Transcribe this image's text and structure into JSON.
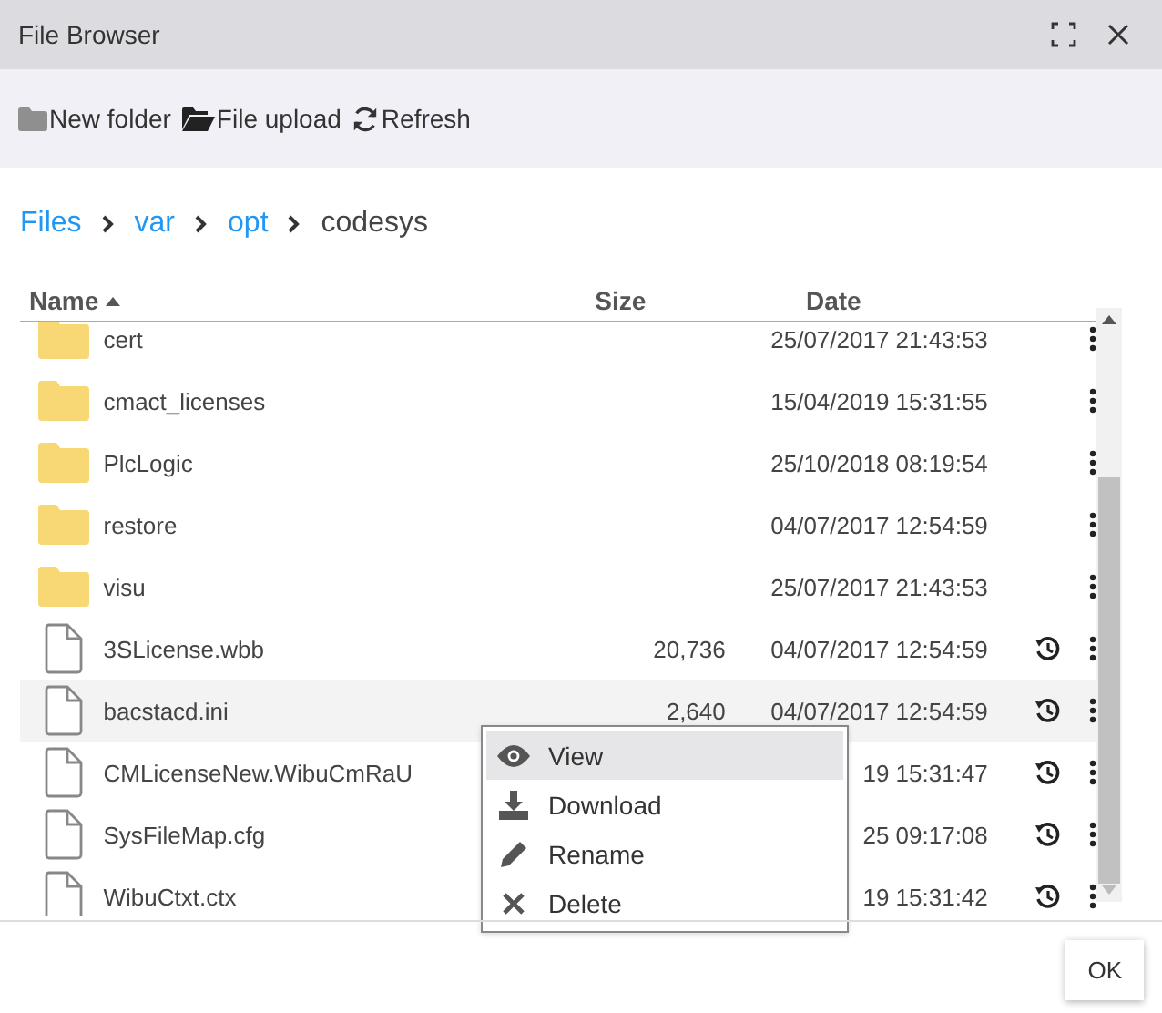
{
  "window": {
    "title": "File Browser"
  },
  "toolbar": [
    {
      "kind": "new-folder",
      "label": "New folder"
    },
    {
      "kind": "upload",
      "label": "File upload"
    },
    {
      "kind": "refresh",
      "label": "Refresh"
    }
  ],
  "breadcrumb": [
    {
      "label": "Files",
      "link": true
    },
    {
      "label": "var",
      "link": true
    },
    {
      "label": "opt",
      "link": true
    },
    {
      "label": "codesys",
      "link": false
    }
  ],
  "table": {
    "columns": [
      {
        "label": "Name",
        "sorted": true
      },
      {
        "label": "Size",
        "sorted": false
      },
      {
        "label": "Date",
        "sorted": false
      }
    ],
    "rows": [
      {
        "kind": "folder",
        "name": "cert",
        "date": "25/07/2017 21:43:53",
        "selected": false
      },
      {
        "kind": "folder",
        "name": "cmact_licenses",
        "date": "15/04/2019 15:31:55",
        "selected": false
      },
      {
        "kind": "folder",
        "name": "PlcLogic",
        "date": "25/10/2018 08:19:54",
        "selected": false
      },
      {
        "kind": "folder",
        "name": "restore",
        "date": "04/07/2017 12:54:59",
        "selected": false
      },
      {
        "kind": "folder",
        "name": "visu",
        "date": "25/07/2017 21:43:53",
        "selected": false
      },
      {
        "kind": "file",
        "name": "3SLicense.wbb",
        "size": "20,736",
        "date": "04/07/2017 12:54:59",
        "selected": false
      },
      {
        "kind": "file",
        "name": "bacstacd.ini",
        "size": "2,640",
        "date": "04/07/2017 12:54:59",
        "selected": true
      },
      {
        "kind": "file",
        "name": "CMLicenseNew.WibuCmRaU",
        "date": "19 15:31:47",
        "selected": false
      },
      {
        "kind": "file",
        "name": "SysFileMap.cfg",
        "date": "25 09:17:08",
        "selected": false
      },
      {
        "kind": "file",
        "name": "WibuCtxt.ctx",
        "date": "19 15:31:42",
        "selected": false
      }
    ]
  },
  "context_menu": [
    {
      "kind": "view",
      "label": "View",
      "selected": true
    },
    {
      "kind": "download",
      "label": "Download",
      "selected": false
    },
    {
      "kind": "rename",
      "label": "Rename",
      "selected": false
    },
    {
      "kind": "delete",
      "label": "Delete",
      "selected": false
    }
  ],
  "buttons": [
    {
      "label": "OK"
    }
  ]
}
